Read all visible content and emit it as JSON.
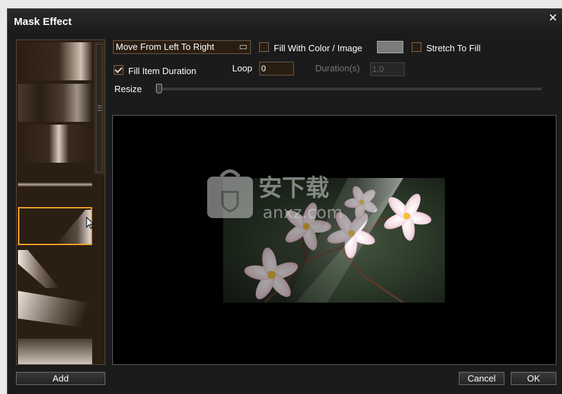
{
  "window": {
    "title": "Mask Effect"
  },
  "controls": {
    "direction": "Move From Left To Right",
    "fill_with_color_label": "Fill With Color / Image",
    "fill_with_color_checked": false,
    "stretch_label": "Stretch To Fill",
    "stretch_checked": false,
    "fill_duration_label": "Fill Item Duration",
    "fill_duration_checked": true,
    "loop_label": "Loop",
    "loop_value": "0",
    "duration_label": "Duration(s)",
    "duration_value": "1.0",
    "resize_label": "Resize",
    "resize_value": 0,
    "fill_color": "#7b7b7b"
  },
  "thumbnails": [
    {
      "pattern": "left-to-right-wipe"
    },
    {
      "pattern": "left-to-right-soft"
    },
    {
      "pattern": "center-bar"
    },
    {
      "pattern": "horizontal-line"
    },
    {
      "pattern": "diagonal-wipe",
      "selected": true
    },
    {
      "pattern": "diagonal-wedge"
    },
    {
      "pattern": "angled-wipe"
    }
  ],
  "buttons": {
    "add": "Add",
    "cancel": "Cancel",
    "ok": "OK"
  },
  "watermark": {
    "text": "安下载",
    "url": "anxz.com"
  },
  "colors": {
    "accent": "#f0a22a",
    "panel": "#2b1e13",
    "dialog": "#1b1b1b"
  }
}
